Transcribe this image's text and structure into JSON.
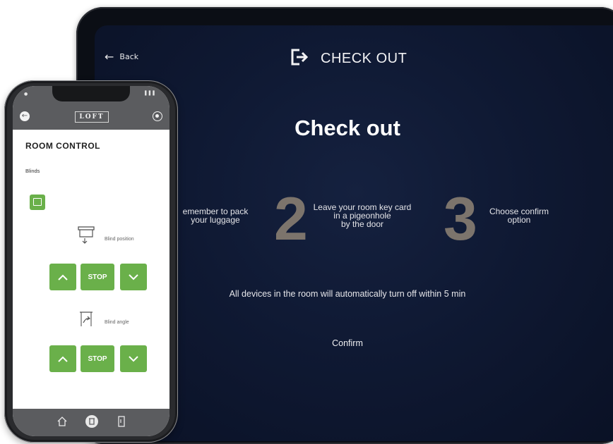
{
  "tablet": {
    "back_label": "Back",
    "header_title": "CHECK OUT",
    "heading": "Check out",
    "steps": [
      {
        "number": "",
        "text_lines": [
          "emember to pack",
          "your luggage"
        ]
      },
      {
        "number": "2",
        "text_lines": [
          "Leave your room key card",
          "in a pigeonhole",
          "by the door"
        ]
      },
      {
        "number": "3",
        "text_lines": [
          "Choose confirm",
          "option"
        ]
      }
    ],
    "notice": "All devices in the room will automatically turn off within 5 min",
    "confirm_label": "Confirm"
  },
  "phone": {
    "logo": "LOFT",
    "title": "ROOM CONTROL",
    "section": "Blinds",
    "position_label": "Blind position",
    "angle_label": "Blind angle",
    "stop_label": "STOP",
    "accent": "#6ab04a",
    "bar_color": "#5b5c5f"
  }
}
